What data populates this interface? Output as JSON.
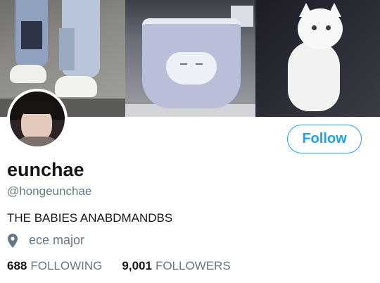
{
  "profile": {
    "display_name": "eunchae",
    "handle": "@hongeunchae",
    "bio": "THE BABIES ANABDMANDBS",
    "location": "ece major",
    "location_icon": "map-pin-icon",
    "follow_label": "Follow",
    "following_count": "688",
    "following_label": "FOLLOWING",
    "followers_count": "9,001",
    "followers_label": "FOLLOWERS"
  },
  "colors": {
    "accent": "#1da1f2",
    "secondary_text": "#657786",
    "primary_text": "#14171a"
  }
}
